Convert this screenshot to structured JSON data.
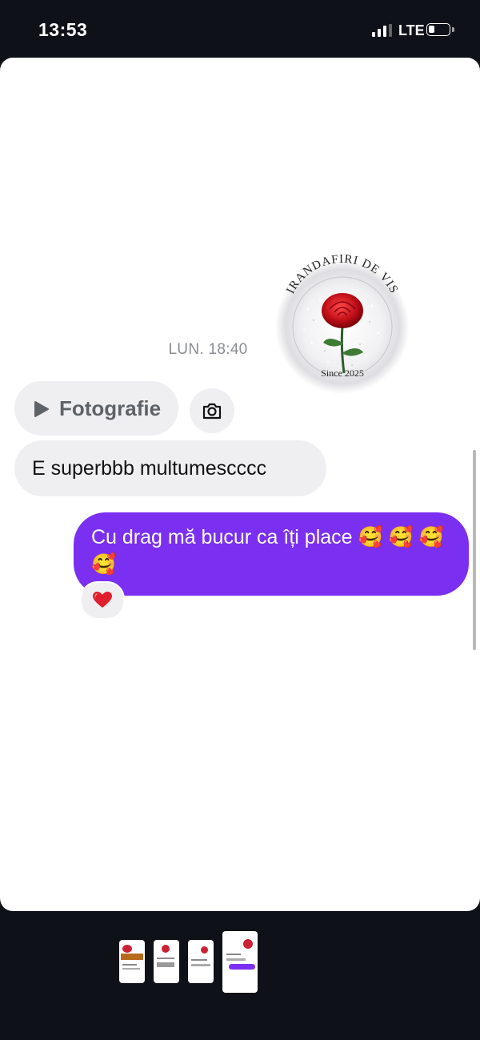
{
  "status_bar": {
    "time": "13:53",
    "network": "LTE",
    "signal_bars": 3,
    "battery_level": 0.3
  },
  "logo": {
    "alt": "IRANDAFIRI DE VIS — Since 2025",
    "arc_text": "IRANDAFIRI DE VIS",
    "since_text": "Since 2025"
  },
  "chat": {
    "timestamp": "LUN. 18:40",
    "photo_label": "Fotografie",
    "play_icon": "play-icon",
    "camera_icon": "camera-icon",
    "incoming_text": "E superbbb multumescccc",
    "outgoing_text": "Cu drag mă bucur ca îți place 🥰 🥰 🥰 🥰",
    "reaction": "heart"
  },
  "colors": {
    "outgoing_bubble": "#7b2ff0",
    "incoming_bubble": "#efeff2",
    "heart": "#e0202e",
    "background": "#0e1117"
  },
  "thumbnails": {
    "count": 4,
    "selected_index": 3
  }
}
